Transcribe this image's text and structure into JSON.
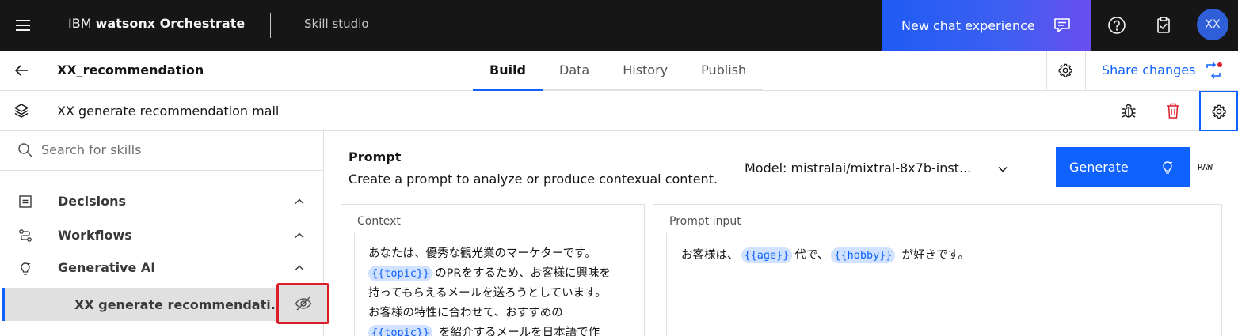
{
  "topbar": {
    "brand_light": "IBM ",
    "brand_bold": "watsonx Orchestrate",
    "app_name": "Skill studio",
    "new_chat_label": "New chat experience",
    "avatar_initials": "XX"
  },
  "titlebar": {
    "skill_name": "XX_recommendation",
    "tabs": [
      {
        "label": "Build",
        "active": true
      },
      {
        "label": "Data",
        "active": false
      },
      {
        "label": "History",
        "active": false
      },
      {
        "label": "Publish",
        "active": false
      }
    ],
    "share_label": "Share changes"
  },
  "skill_header": {
    "title": "XX generate recommendation mail"
  },
  "sidebar": {
    "search_placeholder": "Search for skills",
    "items": [
      {
        "label": "Decisions",
        "icon": "decision-table-icon",
        "expanded": true
      },
      {
        "label": "Workflows",
        "icon": "flow-icon",
        "expanded": true
      },
      {
        "label": "Generative AI",
        "icon": "idea-icon",
        "expanded": true
      }
    ],
    "sub_item_label": "XX generate recommendati..."
  },
  "prompt": {
    "title": "Prompt",
    "subtitle": "Create a prompt to analyze or produce contexual content.",
    "model_label": "Model: mistralai/mixtral-8x7b-inst...",
    "generate_label": "Generate",
    "raw_label": "RAW",
    "context_label": "Context",
    "input_label": "Prompt input",
    "context": {
      "line1": "あなたは、優秀な観光業のマーケターです。",
      "var_topic": "{{topic}}",
      "line2_after": "のPRをするため、お客様に興味を",
      "line3": "持ってもらえるメールを送ろうとしています。",
      "line4": "お客様の特性に合わせて、おすすめの",
      "line5_after": "を紹介するメールを日本語で作"
    },
    "input": {
      "prefix": "お客様は、",
      "var_age": "{{age}}",
      "middle": "代で、",
      "var_hobby": "{{hobby}}",
      "suffix": "が好きです。"
    }
  },
  "colors": {
    "accent": "#0f62fe",
    "topbar_bg": "#161616",
    "danger": "#da1e28",
    "highlight_bg": "#d0e2ff"
  }
}
